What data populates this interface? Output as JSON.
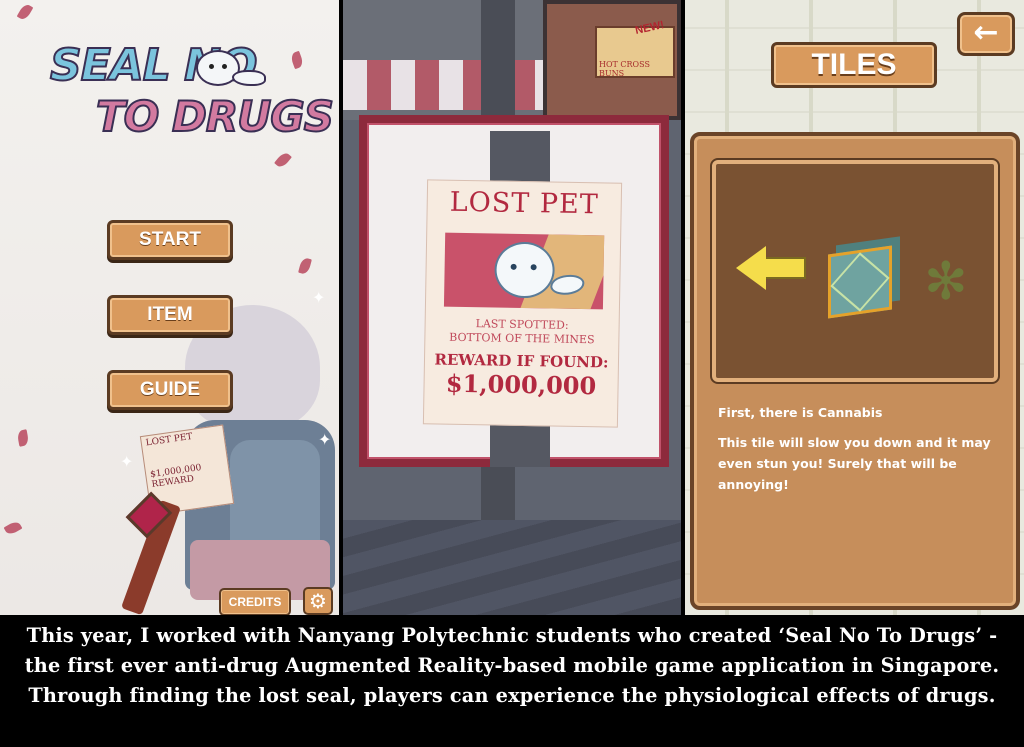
{
  "panel_menu": {
    "logo_line1": "SEAL NO",
    "logo_line2": "TO DRUGS",
    "buttons": [
      "START",
      "ITEM",
      "GUIDE"
    ],
    "credits_label": "CREDITS",
    "settings_icon": "gear-icon",
    "paper_text": "LOST PET",
    "paper_reward": "$1,000,000\nREWARD"
  },
  "panel_ar": {
    "shop_sign": "HOT CROSS BUNS",
    "shop_new": "NEW!",
    "poster_title": "LOST PET",
    "last_spotted_line1": "LAST SPOTTED:",
    "last_spotted_line2": "BOTTOM OF THE MINES",
    "reward_label": "REWARD IF FOUND:",
    "reward_amount": "$1,000,000"
  },
  "panel_tiles": {
    "back_icon": "back-arrow-icon",
    "title": "TILES",
    "heading": "First, there is Cannabis",
    "description": "This tile will slow you down and it may even stun you! Surely that will be annoying!",
    "colors": {
      "button": "#d99a5d",
      "card": "#c68e5b",
      "arrow": "#f5dd4b"
    }
  },
  "caption": "This year, I worked with Nanyang Polytechnic students who created ‘Seal No To Drugs’ - the first ever anti-drug Augmented Reality-based mobile game application in Singapore. Through finding the lost seal, players can experience the physiological effects of drugs."
}
